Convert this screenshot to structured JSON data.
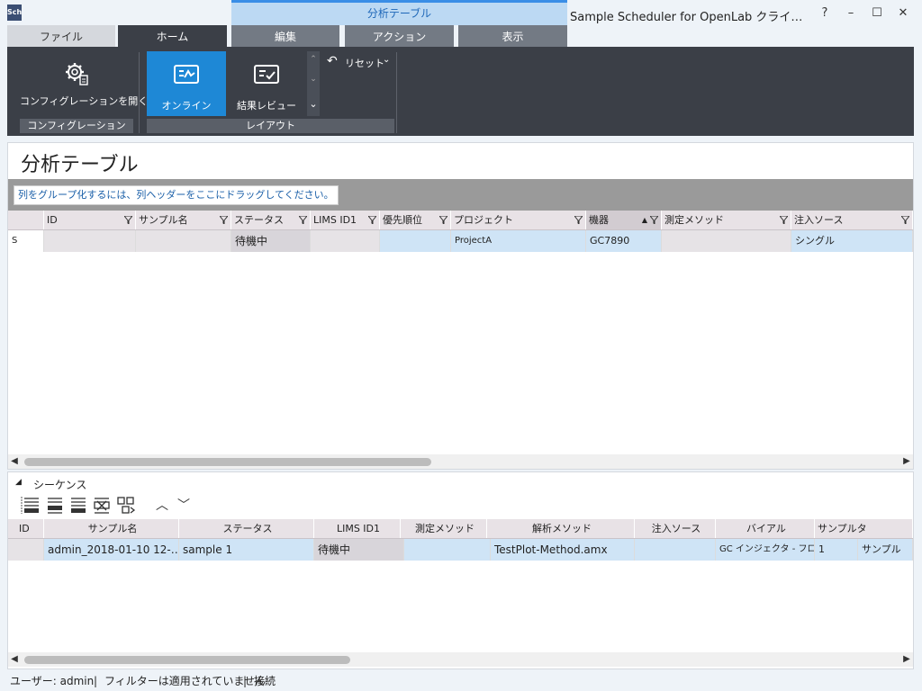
{
  "window": {
    "context_tab": "分析テーブル",
    "title": "Sample Scheduler for OpenLab クライ…",
    "help": "?",
    "minimize": "–",
    "maximize": "☐",
    "close": "✕",
    "app_icon_text": "Sch"
  },
  "tabs": [
    {
      "label": "ファイル"
    },
    {
      "label": "ホーム"
    },
    {
      "label": "編集"
    },
    {
      "label": "アクション"
    },
    {
      "label": "表示"
    }
  ],
  "ribbon": {
    "open_config_label": "コンフィグレーションを開く",
    "config_group_label": "コンフィグレーション",
    "online_label": "オンライン",
    "results_review_label": "結果レビュー",
    "layout_group_label": "レイアウト",
    "reset_label": "リセット"
  },
  "analysis_table": {
    "title": "分析テーブル",
    "group_hint": "列をグループ化するには、列ヘッダーをここにドラッグしてください。",
    "columns": [
      "ID",
      "サンプル名",
      "ステータス",
      "LIMS ID1",
      "優先順位",
      "プロジェクト",
      "機器",
      "測定メソッド",
      "注入ソース"
    ],
    "row": {
      "indicator": "S",
      "id": "",
      "sample_name": "",
      "status": "待機中",
      "lims_id1": "",
      "priority": "",
      "project": "ProjectA",
      "instrument": "GC7890",
      "method": "",
      "injection_source": "シングル"
    }
  },
  "sequence": {
    "title": "シーケンス",
    "columns": [
      "ID",
      "サンプル名",
      "ステータス",
      "LIMS ID1",
      "測定メソッド",
      "解析メソッド",
      "注入ソース",
      "バイアル",
      "サンプルタ"
    ],
    "row": {
      "id": "admin_2018-01-10 12-…",
      "sample_name": "sample 1",
      "status": "待機中",
      "lims_id1": "",
      "method": "TestPlot-Method.amx",
      "analysis_method": "",
      "injection_source": "GC インジェクタ - フロ…",
      "vial": "1",
      "sample_type": "サンプル"
    }
  },
  "status_bar": {
    "user": "ユーザー: admin",
    "filter": "フィルターは適用されていません",
    "connection": "接続",
    "separator": "|"
  },
  "colors": {
    "ribbon_bg": "#3b3f47",
    "active_button": "#1e88d6",
    "selection": "#cfe4f6",
    "accent": "#3a8ee6"
  }
}
